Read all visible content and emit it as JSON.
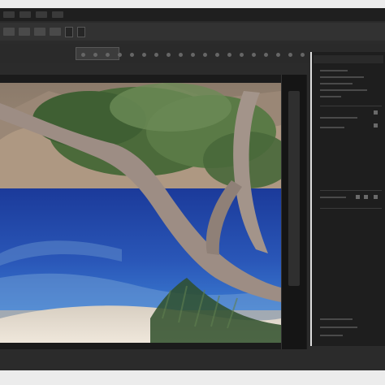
{
  "menubar": {
    "items": [
      "",
      "",
      "",
      ""
    ]
  },
  "options": {
    "fields": [
      "",
      ""
    ]
  },
  "canvas": {
    "scene": ""
  },
  "panel": {
    "tab_label": "",
    "line_count": 11
  },
  "statusbar": {
    "items": [
      "",
      "",
      ""
    ]
  },
  "colors": {
    "bg": "#2b2b2b",
    "panel": "#1e1e1e",
    "accent": "#dcdcdc"
  }
}
